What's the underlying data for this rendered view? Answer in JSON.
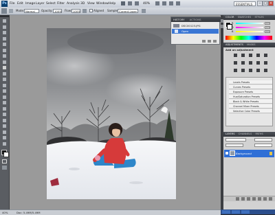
{
  "menu": [
    "File",
    "Edit",
    "Image",
    "Layer",
    "Select",
    "Filter",
    "Analysis",
    "3D",
    "View",
    "Window",
    "Help"
  ],
  "zoom_menu": "40%",
  "workspace": "ESSENTIALS",
  "options": {
    "mode_label": "Mode:",
    "mode_value": "Normal",
    "opacity_label": "Opacity:",
    "opacity_value": "100%",
    "flow_label": "Flow:",
    "flow_value": "100%",
    "aligned_label": "Aligned",
    "sample_label": "Sample:",
    "sample_value": "Current Layer"
  },
  "history": {
    "tabs": [
      "HISTORY",
      "ACTIONS"
    ],
    "rows": [
      "DSC00123.JPG",
      "Open"
    ]
  },
  "color_panel": {
    "tabs": [
      "COLOR",
      "SWATCHES",
      "STYLES"
    ],
    "sliders": [
      {
        "label": "R",
        "value": "255"
      },
      {
        "label": "G",
        "value": "255"
      },
      {
        "label": "B",
        "value": "255"
      }
    ]
  },
  "adjustments": {
    "tabs": [
      "ADJUSTMENTS",
      "MASKS"
    ],
    "title": "Add an adjustment",
    "presets": [
      "Levels Presets",
      "Curves Presets",
      "Exposure Presets",
      "Hue/Saturation Presets",
      "Black & White Presets",
      "Channel Mixer Presets",
      "Selective Color Presets"
    ]
  },
  "layers": {
    "tabs": [
      "LAYERS",
      "CHANNELS",
      "PATHS"
    ],
    "layer_name": "Background"
  },
  "status": {
    "zoom": "40%",
    "doc": "Doc: 5.49M/5.49M"
  },
  "colors": {
    "layer_selected": "#2f6fd6",
    "panel_header": "#3d4046"
  }
}
